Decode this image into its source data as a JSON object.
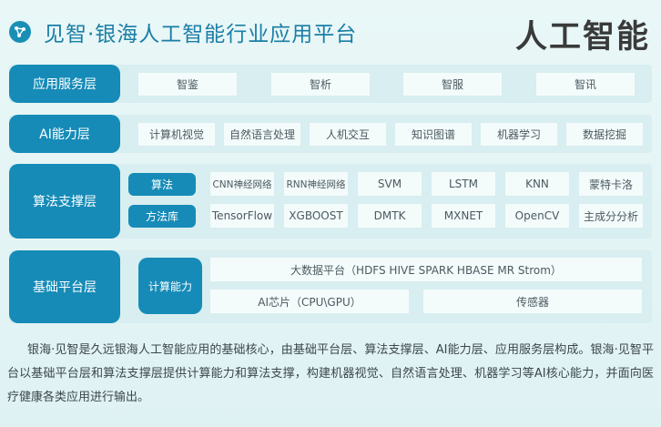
{
  "header": {
    "title": "见智·银海人工智能行业应用平台",
    "right_title": "人工智能",
    "logo_icon": "network-icon"
  },
  "layers": {
    "service": {
      "label": "应用服务层",
      "items": [
        "智鉴",
        "智析",
        "智服",
        "智讯"
      ]
    },
    "ai": {
      "label": "AI能力层",
      "items": [
        "计算机视觉",
        "自然语言处理",
        "人机交互",
        "知识图谱",
        "机器学习",
        "数据挖掘"
      ]
    },
    "algo": {
      "label": "算法支撑层",
      "row1_label": "算法",
      "row1_items": [
        "CNN神经网络",
        "RNN神经网络",
        "SVM",
        "LSTM",
        "KNN",
        "蒙特卡洛"
      ],
      "row2_label": "方法库",
      "row2_items": [
        "TensorFlow",
        "XGBOOST",
        "DMTK",
        "MXNET",
        "OpenCV",
        "主成分分析"
      ]
    },
    "base": {
      "label": "基础平台层",
      "compute_label": "计算能力",
      "bigdata": "大数据平台（HDFS HIVE SPARK HBASE MR Strom）",
      "chip": "AI芯片（CPU\\GPU）",
      "sensor": "传感器"
    }
  },
  "description": "银海·见智是久远银海人工智能应用的基础核心，由基础平台层、算法支撑层、AI能力层、应用服务层构成。银海·见智平台以基础平台层和算法支撑层提供计算能力和算法支撑，构建机器视觉、自然语言处理、机器学习等AI核心能力，并面向医疗健康各类应用进行输出。",
  "colors": {
    "accent": "#168bb7",
    "title": "#1a7ea6",
    "background": "#e5f5f5"
  }
}
